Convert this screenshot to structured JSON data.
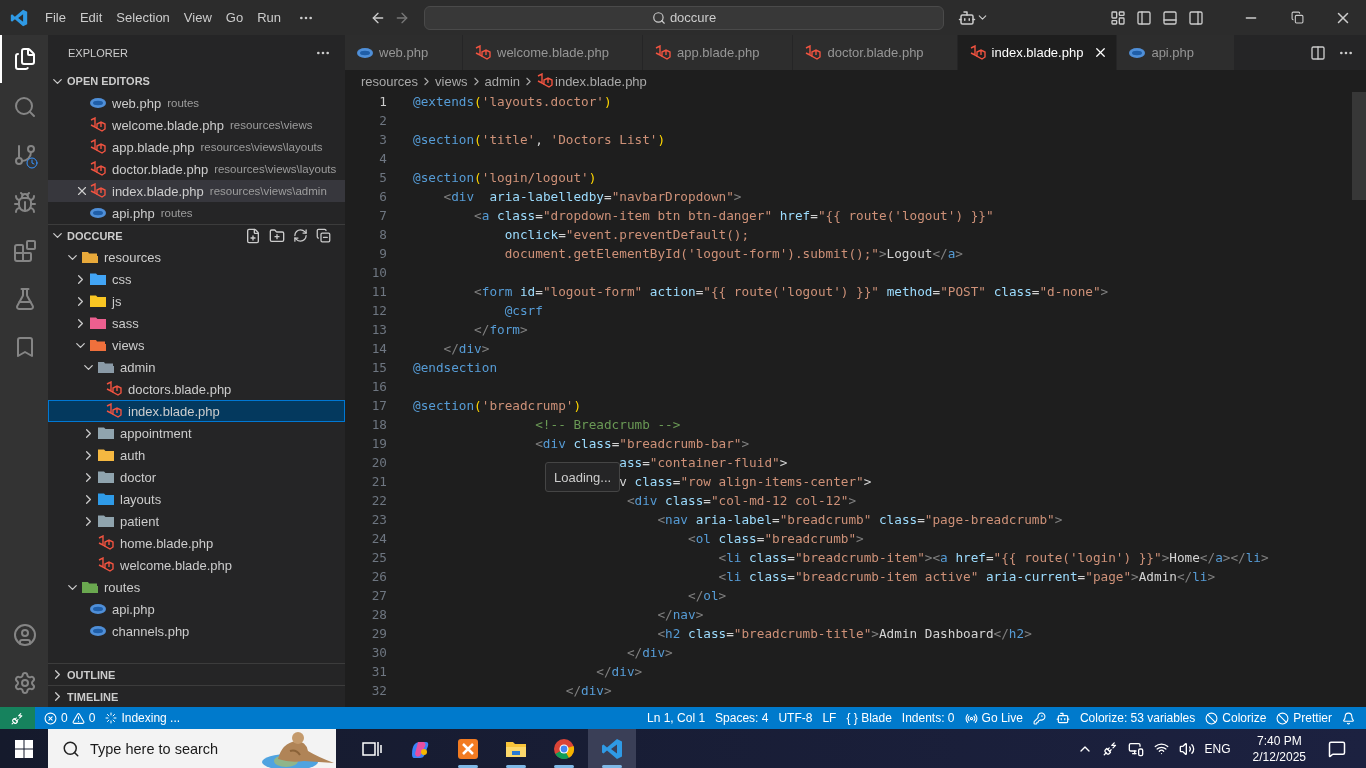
{
  "titlebar": {
    "menu": [
      "File",
      "Edit",
      "Selection",
      "View",
      "Go",
      "Run"
    ],
    "search": "doccure"
  },
  "explorer": {
    "title": "EXPLORER",
    "open_editors": {
      "title": "OPEN EDITORS",
      "expanded": true,
      "items": [
        {
          "name": "web.php",
          "path": "routes",
          "kind": "php",
          "active": false
        },
        {
          "name": "welcome.blade.php",
          "path": "resources\\views",
          "kind": "blade",
          "active": false
        },
        {
          "name": "app.blade.php",
          "path": "resources\\views\\layouts",
          "kind": "blade",
          "active": false
        },
        {
          "name": "doctor.blade.php",
          "path": "resources\\views\\layouts",
          "kind": "blade",
          "active": false
        },
        {
          "name": "index.blade.php",
          "path": "resources\\views\\admin",
          "kind": "blade",
          "active": true
        },
        {
          "name": "api.php",
          "path": "routes",
          "kind": "php",
          "active": false
        }
      ]
    },
    "project": {
      "title": "DOCCURE",
      "expanded": true,
      "tree": [
        {
          "name": "resources",
          "kind": "folder",
          "color": "#e8a93a",
          "expanded": true,
          "selected": false,
          "children": [
            {
              "name": "css",
              "kind": "folder",
              "color": "#42a5f5",
              "expanded": false,
              "selected": false
            },
            {
              "name": "js",
              "kind": "folder",
              "color": "#f9c623",
              "expanded": false,
              "selected": false
            },
            {
              "name": "sass",
              "kind": "folder",
              "color": "#ec5f8f",
              "expanded": false,
              "selected": false
            },
            {
              "name": "views",
              "kind": "folder",
              "color": "#f0703c",
              "expanded": true,
              "selected": false,
              "children": [
                {
                  "name": "admin",
                  "kind": "folder",
                  "color": "#8a9aa6",
                  "expanded": true,
                  "selected": false,
                  "children": [
                    {
                      "name": "doctors.blade.php",
                      "kind": "blade",
                      "selected": false
                    },
                    {
                      "name": "index.blade.php",
                      "kind": "blade",
                      "selected": true
                    }
                  ]
                },
                {
                  "name": "appointment",
                  "kind": "folder",
                  "color": "#90a4ae",
                  "expanded": false,
                  "selected": false
                },
                {
                  "name": "auth",
                  "kind": "folder",
                  "color": "#f5b841",
                  "expanded": false,
                  "selected": false
                },
                {
                  "name": "doctor",
                  "kind": "folder",
                  "color": "#90a4ae",
                  "expanded": false,
                  "selected": false
                },
                {
                  "name": "layouts",
                  "kind": "folder",
                  "color": "#2f9be8",
                  "expanded": false,
                  "selected": false
                },
                {
                  "name": "patient",
                  "kind": "folder",
                  "color": "#90a4ae",
                  "expanded": false,
                  "selected": false
                },
                {
                  "name": "home.blade.php",
                  "kind": "blade",
                  "selected": false
                },
                {
                  "name": "welcome.blade.php",
                  "kind": "blade",
                  "selected": false
                }
              ]
            }
          ]
        },
        {
          "name": "routes",
          "kind": "folder",
          "color": "#6aa84f",
          "expanded": true,
          "selected": false,
          "children": [
            {
              "name": "api.php",
              "kind": "php",
              "selected": false
            },
            {
              "name": "channels.php",
              "kind": "php",
              "selected": false
            }
          ]
        }
      ]
    },
    "outline": {
      "title": "OUTLINE",
      "expanded": false
    },
    "timeline": {
      "title": "TIMELINE",
      "expanded": false
    }
  },
  "editor": {
    "tabs": [
      {
        "label": "web.php",
        "kind": "php",
        "selected": false
      },
      {
        "label": "welcome.blade.php",
        "kind": "blade",
        "selected": false
      },
      {
        "label": "app.blade.php",
        "kind": "blade",
        "selected": false
      },
      {
        "label": "doctor.blade.php",
        "kind": "blade",
        "selected": false
      },
      {
        "label": "index.blade.php",
        "kind": "blade",
        "selected": true
      },
      {
        "label": "api.php",
        "kind": "php",
        "selected": false
      }
    ],
    "breadcrumb": [
      "resources",
      "views",
      "admin",
      "index.blade.php"
    ],
    "lines": [
      {
        "n": "1",
        "text": "@extends('layouts.doctor')",
        "current": true
      },
      {
        "n": "2",
        "current": false
      },
      {
        "n": "3",
        "text": "@section('title', 'Doctors List')",
        "current": false
      },
      {
        "n": "4",
        "current": false
      },
      {
        "n": "5",
        "text": "@section('login/logout')",
        "current": false
      },
      {
        "n": "6",
        "text": "    <div  aria-labelledby=\"navbarDropdown\">",
        "current": false
      },
      {
        "n": "7",
        "text": "        <a class=\"dropdown-item btn btn-danger\" href=\"{{ route('logout') }}\"",
        "current": false
      },
      {
        "n": "8",
        "text": "            onclick=\"event.preventDefault();",
        "current": false
      },
      {
        "n": "9",
        "text": "            document.getElementById('logout-form').submit();\">Logout</a>",
        "current": false
      },
      {
        "n": "10",
        "current": false
      },
      {
        "n": "11",
        "text": "        <form id=\"logout-form\" action=\"{{ route('logout') }}\" method=\"POST\" class=\"d-none\">",
        "current": false
      },
      {
        "n": "12",
        "text": "            @csrf",
        "current": false
      },
      {
        "n": "13",
        "text": "        </form>",
        "current": false
      },
      {
        "n": "14",
        "text": "    </div>",
        "current": false
      },
      {
        "n": "15",
        "text": "@endsection",
        "current": false
      },
      {
        "n": "16",
        "current": false
      },
      {
        "n": "17",
        "text": "@section('breadcrump')",
        "current": false
      },
      {
        "n": "18",
        "text": "                <!-- Breadcrumb -->",
        "current": false
      },
      {
        "n": "19",
        "text": "                <div class=\"breadcrumb-bar\">",
        "current": false
      },
      {
        "n": "20",
        "text": "                           ass=\"container-fluid\">",
        "current": false
      },
      {
        "n": "21",
        "text": "                           v class=\"row align-items-center\">",
        "current": false
      },
      {
        "n": "22",
        "text": "                            <div class=\"col-md-12 col-12\">",
        "current": false
      },
      {
        "n": "23",
        "text": "                                <nav aria-label=\"breadcrumb\" class=\"page-breadcrumb\">",
        "current": false
      },
      {
        "n": "24",
        "text": "                                    <ol class=\"breadcrumb\">",
        "current": false
      },
      {
        "n": "25",
        "text": "                                        <li class=\"breadcrumb-item\"><a href=\"{{ route('login') }}\">Home</a></li>",
        "current": false
      },
      {
        "n": "26",
        "text": "                                        <li class=\"breadcrumb-item active\" aria-current=\"page\">Admin</li>",
        "current": false
      },
      {
        "n": "27",
        "text": "                                    </ol>",
        "current": false
      },
      {
        "n": "28",
        "text": "                                </nav>",
        "current": false
      },
      {
        "n": "29",
        "text": "                                <h2 class=\"breadcrumb-title\">Admin Dashboard</h2>",
        "current": false
      },
      {
        "n": "30",
        "text": "                            </div>",
        "current": false
      },
      {
        "n": "31",
        "text": "                        </div>",
        "current": false
      },
      {
        "n": "32",
        "text": "                    </div>",
        "current": false
      }
    ],
    "tooltip": "Loading..."
  },
  "status_bar": {
    "errors": "0",
    "warnings": "0",
    "indexing": "Indexing ...",
    "right": [
      {
        "kind": "text",
        "label": "Ln 1, Col 1"
      },
      {
        "kind": "text",
        "label": "Spaces: 4"
      },
      {
        "kind": "text",
        "label": "UTF-8"
      },
      {
        "kind": "text",
        "label": "LF"
      },
      {
        "kind": "text",
        "label": "{ } Blade"
      },
      {
        "kind": "text",
        "label": "Indents: 0"
      },
      {
        "kind": "live",
        "label": "Go Live"
      },
      {
        "kind": "key"
      },
      {
        "kind": "copilot"
      },
      {
        "kind": "text",
        "label": "Colorize: 53 variables"
      },
      {
        "kind": "blocked",
        "label": "Colorize"
      },
      {
        "kind": "blocked",
        "label": "Prettier"
      },
      {
        "kind": "bell"
      }
    ]
  },
  "taskbar": {
    "search": "Type here to search",
    "apps": [
      {
        "kind": "taskview",
        "running": false,
        "selected": false
      },
      {
        "kind": "copilot",
        "running": false,
        "selected": false
      },
      {
        "kind": "xampp",
        "running": true,
        "selected": false
      },
      {
        "kind": "files",
        "running": true,
        "selected": false
      },
      {
        "kind": "browser",
        "running": true,
        "selected": false
      },
      {
        "kind": "code",
        "running": true,
        "selected": true
      }
    ],
    "language": "ENG",
    "time": "7:40 PM",
    "date": "2/12/2025"
  }
}
